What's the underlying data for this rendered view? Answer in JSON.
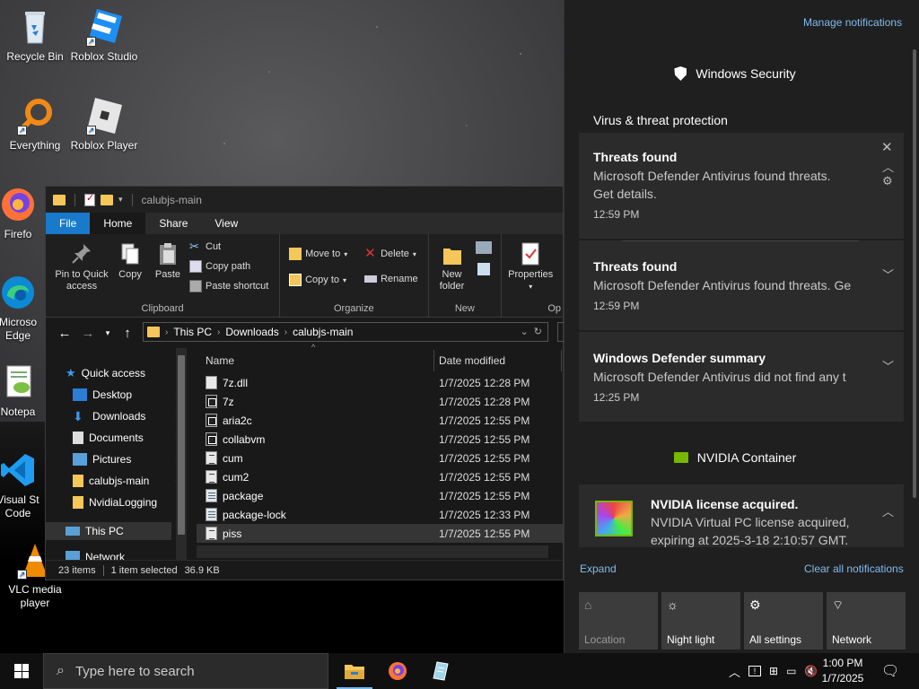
{
  "desktop": {
    "icons": [
      {
        "label": "Recycle Bin"
      },
      {
        "label": "Roblox Studio"
      },
      {
        "label": "Everything"
      },
      {
        "label": "Roblox Player"
      },
      {
        "label": "Firefo"
      },
      {
        "label": "Microso Edge"
      },
      {
        "label": "Notepa"
      },
      {
        "label": "Visual St Code"
      },
      {
        "label": "VLC media player"
      }
    ]
  },
  "explorer": {
    "title": "calubjs-main",
    "tabs": [
      "File",
      "Home",
      "Share",
      "View"
    ],
    "ribbon": {
      "pin": "Pin to Quick access",
      "copy": "Copy",
      "paste": "Paste",
      "cut": "Cut",
      "copy_path": "Copy path",
      "paste_shortcut": "Paste shortcut",
      "clipboard": "Clipboard",
      "move_to": "Move to",
      "copy_to": "Copy to",
      "delete": "Delete",
      "rename": "Rename",
      "organize": "Organize",
      "new_folder": "New folder",
      "new": "New",
      "properties": "Properties",
      "open": "Op"
    },
    "breadcrumb": [
      "This PC",
      "Downloads",
      "calubjs-main"
    ],
    "nav_items": [
      {
        "label": "Quick access"
      },
      {
        "label": "Desktop"
      },
      {
        "label": "Downloads"
      },
      {
        "label": "Documents"
      },
      {
        "label": "Pictures"
      },
      {
        "label": "calubjs-main"
      },
      {
        "label": "NvidiaLogging"
      },
      {
        "label": "This PC"
      },
      {
        "label": "Network"
      }
    ],
    "columns": {
      "name": "Name",
      "date": "Date modified"
    },
    "files": [
      {
        "name": "7z.dll",
        "date": "1/7/2025 12:28 PM",
        "icon": "dll-file-icon"
      },
      {
        "name": "7z",
        "date": "1/7/2025 12:28 PM",
        "icon": "app-icon"
      },
      {
        "name": "aria2c",
        "date": "1/7/2025 12:55 PM",
        "icon": "app-icon"
      },
      {
        "name": "collabvm",
        "date": "1/7/2025 12:55 PM",
        "icon": "app-icon"
      },
      {
        "name": "cum",
        "date": "1/7/2025 12:55 PM",
        "icon": "script-icon"
      },
      {
        "name": "cum2",
        "date": "1/7/2025 12:55 PM",
        "icon": "script-icon"
      },
      {
        "name": "package",
        "date": "1/7/2025 12:55 PM",
        "icon": "json-file-icon"
      },
      {
        "name": "package-lock",
        "date": "1/7/2025 12:33 PM",
        "icon": "json-file-icon"
      },
      {
        "name": "piss",
        "date": "1/7/2025 12:55 PM",
        "icon": "script-icon"
      }
    ],
    "status": {
      "items": "23 items",
      "selected": "1 item selected",
      "size": "36.9 KB"
    }
  },
  "action_center": {
    "manage": "Manage notifications",
    "ws_app": "Windows Security",
    "ws_group": "Virus & threat protection",
    "notifications": [
      {
        "title": "Threats found",
        "body1": "Microsoft Defender Antivirus found threats.",
        "body2": "Get details.",
        "time": "12:59 PM"
      },
      {
        "title": "Threats found",
        "body1": "Microsoft Defender Antivirus found threats. Ge",
        "time": "12:59 PM"
      },
      {
        "title": "Windows Defender summary",
        "body1": "Microsoft Defender Antivirus did not find any t",
        "time": "12:25 PM"
      }
    ],
    "nv_app": "NVIDIA Container",
    "nv_notification": {
      "title": "NVIDIA license acquired.",
      "body1": "NVIDIA Virtual PC license acquired,",
      "body2": "expiring at 2025-3-18 2:10:57 GMT."
    },
    "expand": "Expand",
    "clear_all": "Clear all notifications",
    "quick_actions": [
      {
        "label": "Location",
        "icon": "location-icon"
      },
      {
        "label": "Night light",
        "icon": "night-light-icon"
      },
      {
        "label": "All settings",
        "icon": "gear-icon"
      },
      {
        "label": "Network",
        "icon": "network-icon"
      }
    ]
  },
  "taskbar": {
    "search_placeholder": "Type here to search",
    "time": "1:00 PM",
    "date": "1/7/2025"
  },
  "colors": {
    "accent": "#1979ca",
    "link": "#7fbbf0",
    "nvidia": "#76b900",
    "folder": "#f5c75a"
  }
}
